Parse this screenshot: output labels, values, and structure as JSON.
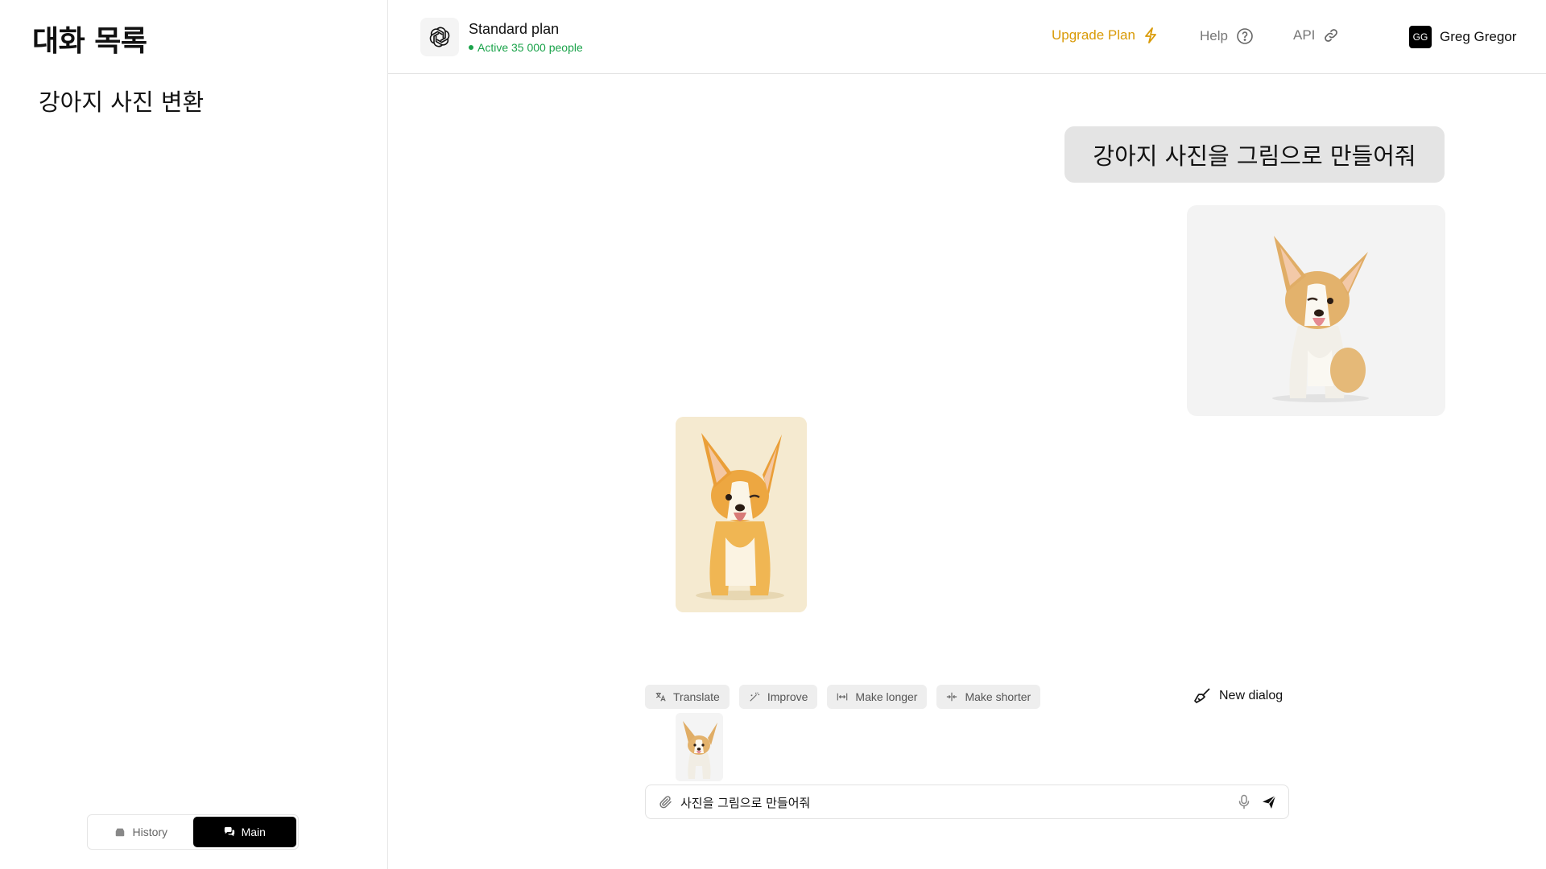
{
  "sidebar": {
    "title": "대화 목록",
    "conversations": [
      "강아지 사진 변환"
    ],
    "tabs": [
      {
        "label": "History",
        "active": false
      },
      {
        "label": "Main",
        "active": true
      }
    ]
  },
  "header": {
    "plan_name": "Standard plan",
    "plan_active": "Active 35 000 people",
    "upgrade_label": "Upgrade Plan",
    "help_label": "Help",
    "api_label": "API",
    "user_initials": "GG",
    "user_name": "Greg Gregor",
    "accent_color": "#d99a06",
    "status_color": "#1aa34a"
  },
  "chat": {
    "user_message": "강아지 사진을 그림으로 만들어줘",
    "images": [
      {
        "name": "corgi-photo",
        "icon": "corgi-photo-image"
      },
      {
        "name": "corgi-painting",
        "icon": "corgi-painting-image"
      }
    ]
  },
  "composer": {
    "tools": [
      {
        "label": "Translate",
        "icon": "translate-icon"
      },
      {
        "label": "Improve",
        "icon": "magic-wand-icon"
      },
      {
        "label": "Make longer",
        "icon": "expand-icon"
      },
      {
        "label": "Make shorter",
        "icon": "shrink-icon"
      }
    ],
    "new_dialog_label": "New dialog",
    "input_value": "사진을 그림으로 만들어줘",
    "attachment": "corgi-photo-thumbnail"
  }
}
